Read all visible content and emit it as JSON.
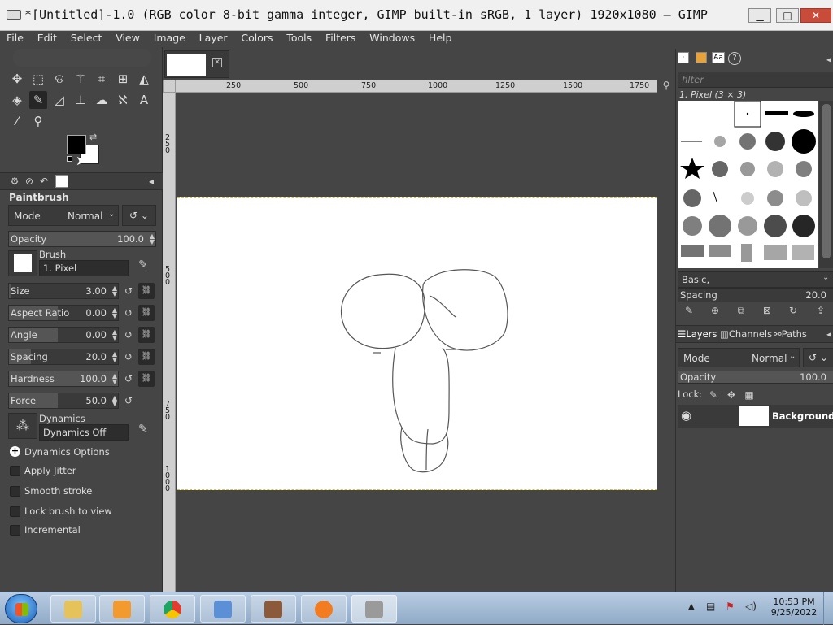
{
  "window": {
    "title": "*[Untitled]-1.0 (RGB color 8-bit gamma integer, GIMP built-in sRGB, 1 layer) 1920x1080 – GIMP",
    "minimize": "▁",
    "maximize": "□",
    "close": "✕"
  },
  "menu": [
    "File",
    "Edit",
    "Select",
    "View",
    "Image",
    "Layer",
    "Colors",
    "Tools",
    "Filters",
    "Windows",
    "Help"
  ],
  "tool_options": {
    "tool_name": "Paintbrush",
    "mode_label": "Mode",
    "mode_value": "Normal",
    "opacity_label": "Opacity",
    "opacity_value": "100.0",
    "opacity_fraction": 1.0,
    "brush_label": "Brush",
    "brush_value": "1. Pixel",
    "size_label": "Size",
    "size_value": "3.00",
    "aspect_label": "Aspect Ratio",
    "aspect_value": "0.00",
    "angle_label": "Angle",
    "angle_value": "0.00",
    "spacing_label": "Spacing",
    "spacing_value": "20.0",
    "hardness_label": "Hardness",
    "hardness_value": "100.0",
    "force_label": "Force",
    "force_value": "50.0",
    "dynamics_label": "Dynamics",
    "dynamics_value": "Dynamics Off",
    "dynamics_options": "Dynamics Options",
    "apply_jitter": "Apply Jitter",
    "smooth_stroke": "Smooth stroke",
    "lock_brush": "Lock brush to view",
    "incremental": "Incremental"
  },
  "rulers": {
    "h_ticks": [
      "250",
      "500",
      "750",
      "1000",
      "1250",
      "1500",
      "1750"
    ],
    "v_ticks": [
      "250",
      "500",
      "750",
      "1000"
    ]
  },
  "brushes": {
    "filter_placeholder": "filter",
    "selected_brush": "1. Pixel (3 × 3)",
    "tag": "Basic,",
    "spacing_label": "Spacing",
    "spacing_value": "20.0"
  },
  "layers": {
    "tab_layers": "Layers",
    "tab_channels": "Channels",
    "tab_paths": "Paths",
    "mode_label": "Mode",
    "mode_value": "Normal",
    "opacity_label": "Opacity",
    "opacity_value": "100.0",
    "lock_label": "Lock:",
    "layer_name": "Background"
  },
  "taskbar": {
    "time": "10:53 PM",
    "date": "9/25/2022"
  },
  "colors": {
    "foreground": "#000000",
    "background": "#ffffff",
    "accent_selection": "#d9c640"
  }
}
